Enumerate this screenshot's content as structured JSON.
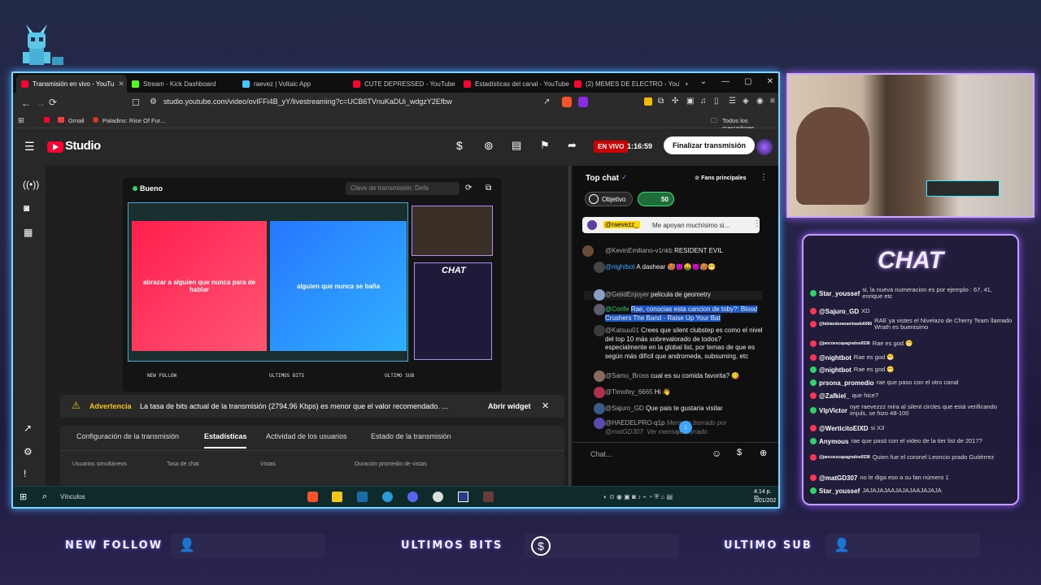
{
  "browser": {
    "tabs": [
      {
        "label": "Transmisión en vivo - YouTu",
        "color": "#ff0033",
        "active": true
      },
      {
        "label": "Stream - Kick Dashboard",
        "color": "#53fc18"
      },
      {
        "label": "raevez | Voltaic App",
        "color": "#3ec8ff"
      },
      {
        "label": "CUTE DEPRESSED - YouTube",
        "color": "#ff0033"
      },
      {
        "label": "Estadísticas del canal - YouTube",
        "color": "#ff0033"
      },
      {
        "label": "(2) MEMES DE ELECTRO - YouTu",
        "color": "#ff0033"
      }
    ],
    "url": "studio.youtube.com/video/ovIFFi4B_yY/livestreaming?c=UCB6TVnuKaDUi_wdgzY2Efbw",
    "bookmarks": [
      "Gmail",
      "Paladins: Rise Of Fur..."
    ],
    "all_bookmarks": "Todos los marcadores"
  },
  "studio": {
    "logo": "Studio",
    "live_badge": "EN VIVO",
    "timer": "1:16:59",
    "end_button": "Finalizar transmisión",
    "preview_status": "Bueno",
    "stream_key_placeholder": "Clave de transmisión: Defa",
    "preview_cards": [
      "abrazar a alguien que nunca para de hablar",
      "alguien que nunca se baña"
    ],
    "preview_labels": [
      "NEW FOLLOW",
      "ULTIMOS BITS",
      "ULTIMO SUB"
    ],
    "preview_chat_title": "CHAT",
    "warning_title": "Advertencia",
    "warning_text": "La tasa de bits actual de la transmisión (2794.96 Kbps) es menor que el valor recomendado. ...",
    "warning_button": "Abrir widget",
    "tabs": [
      "Configuración de la transmisión",
      "Estadísticas",
      "Actividad de los usuarios",
      "Estado de la transmisión"
    ],
    "stats": [
      "Usuarios simultáneos",
      "Tasa de chat",
      "Vistas",
      "Duración promedio de vistas"
    ]
  },
  "chat": {
    "title": "Top chat",
    "fans": "Fans principales",
    "goal": "Objetivo",
    "goal_count": "50",
    "pinned_user": "@raevezz_",
    "pinned_text": "Me apoyan muchísimo si...",
    "messages": [
      {
        "user": "@KevinEmiliano-v1nkb",
        "text": "RESIDENT EVIL"
      },
      {
        "user": "@nightbot",
        "text": "A dashear 🥵😈🤑😈🥵😁"
      },
      {
        "user": "@GelidEnjoyer",
        "text": "pelicula de geometry"
      },
      {
        "user": "@Corife",
        "text": "Rae, conocias esta cancion de toby?: Blood Crushers The Band - Raise Up Your Bat"
      },
      {
        "user": "@Katsuu01",
        "text": "Crees que silent clubstep es como el nivel del top 10 más sobrevalorado de todos? especialmente en la global list, por temas de que es según más difícil que andromeda, subsuming, etc"
      },
      {
        "user": "@Samu_Bross",
        "text": "cual es su comida favorita? 😋"
      },
      {
        "user": "@Timofey_6665",
        "text": "Hi 👋"
      },
      {
        "user": "@Sajuro_GD",
        "text": "Que pais te gustaria visitar"
      },
      {
        "user": "@HAEDELPRO-q1p",
        "text": "Mensaje borrado por @matGD307. Ver mensaje borrado"
      }
    ],
    "input_placeholder": "Chat..."
  },
  "taskbar": {
    "search": "Vínculos",
    "time": "4:14 p. m.",
    "date": "3/01/202"
  },
  "overlay": {
    "chat_title": "CHAT",
    "messages": [
      {
        "user": "Star_youssef",
        "text": "si, la nueva numeracion es por ejemplo : 67, 41, enrique etc",
        "color": "#2fd36a"
      },
      {
        "user": "@Sajuro_GD",
        "text": "XD",
        "color": "#ff3355"
      },
      {
        "user": "@fabiandurananimado6666",
        "text": "RAE ya vistes el Nivelazo de Cherry Team llamado Wrath es buenisimo",
        "color": "#ff3355"
      },
      {
        "user": "@jancoescapagrados6538",
        "text": "Rae es god 😁",
        "color": "#ff3355"
      },
      {
        "user": "@nightbot",
        "text": "Rae es god 😁",
        "color": "#ff3355"
      },
      {
        "user": "@nightbot",
        "text": "Rae es god 😁",
        "color": "#2fd36a"
      },
      {
        "user": "prsona_promedio",
        "text": "rae que paso con el otro canal",
        "color": "#2fd36a"
      },
      {
        "user": "@Zafkiel_",
        "text": "que hice?",
        "color": "#ff3355"
      },
      {
        "user": "VlpVictor",
        "text": "oye raevezzz mira al silent circles que está verificando imjuls, se hizo 48-100",
        "color": "#2fd36a"
      },
      {
        "user": "@WerticitoEIXD",
        "text": "si X3",
        "color": "#ff3355"
      },
      {
        "user": "Anymous",
        "text": "rae que pasó con el video de la tier list de 2017?",
        "color": "#2fd36a"
      },
      {
        "user": "@jancoescapagrados6538",
        "text": "Quien fue el coronel Leoncio prado Gutiérrez",
        "color": "#ff3355"
      },
      {
        "user": "@matGD307",
        "text": "no le diga eso a su fan número 1",
        "color": "#ff3355"
      },
      {
        "user": "Star_youssef",
        "text": "JAJAJAJAAJAJAJAAJAJAJA",
        "color": "#2fd36a"
      }
    ],
    "bottom": [
      "NEW FOLLOW",
      "ULTIMOS BITS",
      "ULTIMO SUB"
    ]
  }
}
